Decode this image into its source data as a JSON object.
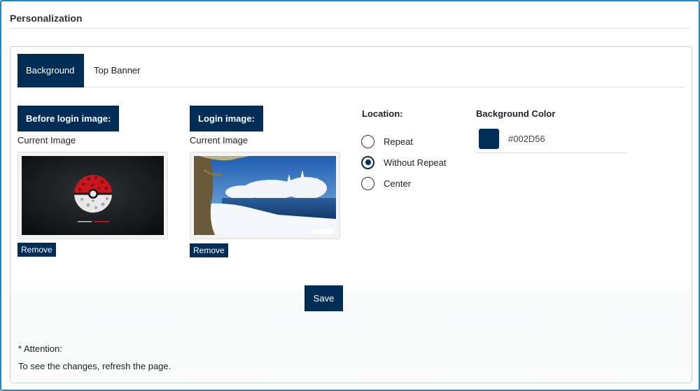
{
  "section": {
    "title": "Personalization"
  },
  "tabs": [
    {
      "label": "Background",
      "active": true
    },
    {
      "label": "Top Banner",
      "active": false
    }
  ],
  "before_login": {
    "header": "Before login image:",
    "current_label": "Current Image",
    "remove_label": "Remove"
  },
  "login": {
    "header": "Login image:",
    "current_label": "Current Image",
    "remove_label": "Remove"
  },
  "location": {
    "label": "Location:",
    "options": [
      {
        "label": "Repeat",
        "checked": false
      },
      {
        "label": "Without Repeat",
        "checked": true
      },
      {
        "label": "Center",
        "checked": false
      }
    ]
  },
  "background_color": {
    "label": "Background Color",
    "value": "#002D56"
  },
  "actions": {
    "save_label": "Save"
  },
  "notes": {
    "attention": "* Attention:",
    "refresh": "To see the changes, refresh the page."
  },
  "colors": {
    "primary": "#002D56",
    "frame_border": "#1f86c9"
  }
}
